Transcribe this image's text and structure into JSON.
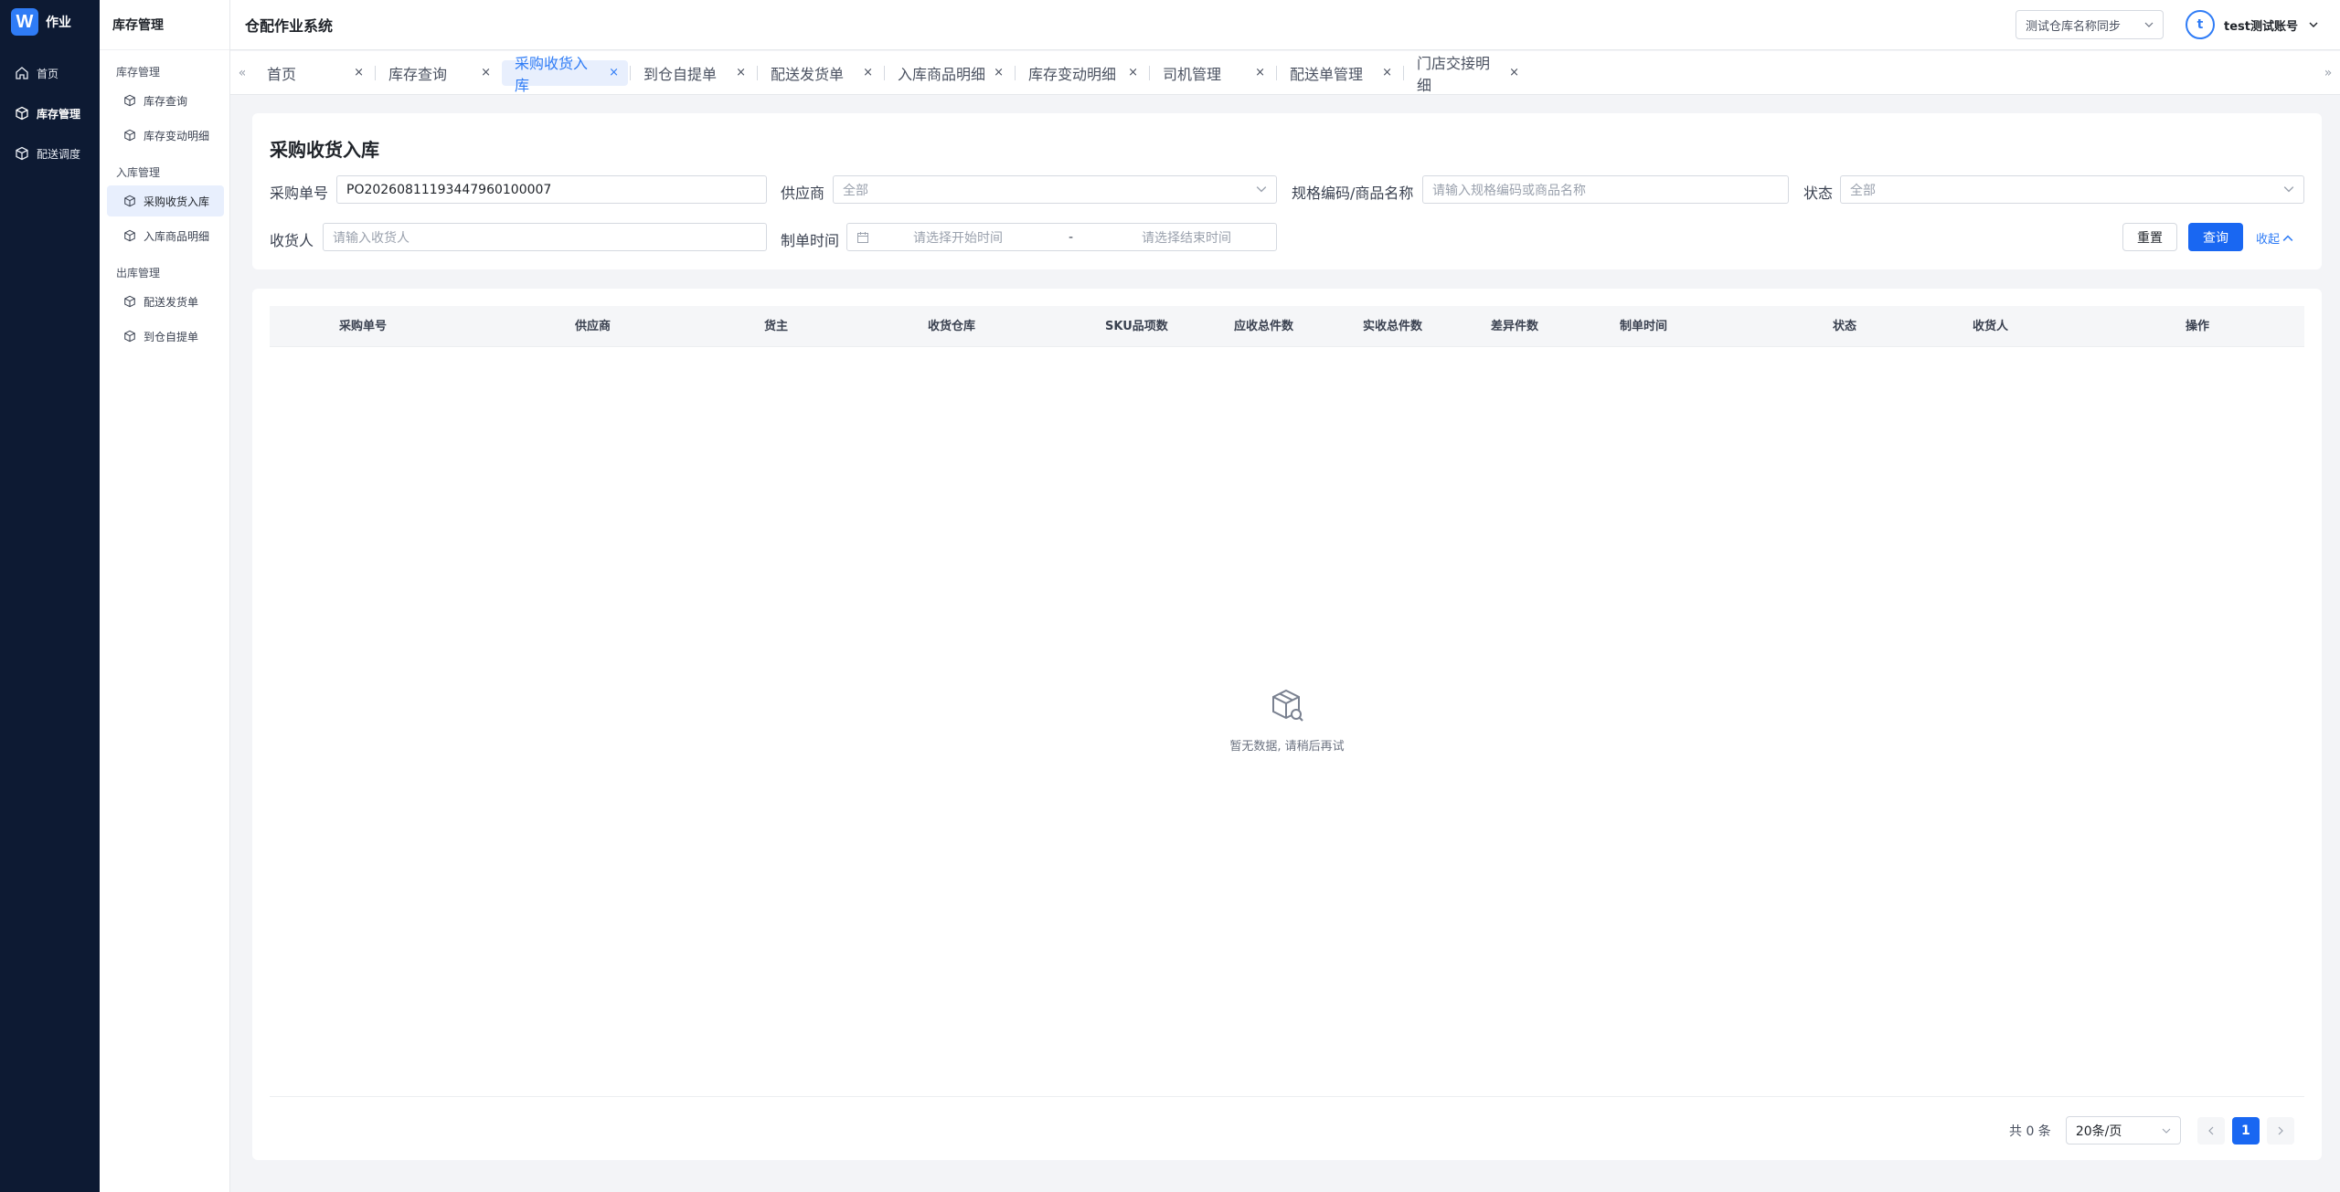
{
  "brand": {
    "logo_letter": "W",
    "name": "作业"
  },
  "rail": [
    {
      "label": "首页",
      "icon": "home-icon",
      "active": false
    },
    {
      "label": "库存管理",
      "icon": "box-icon",
      "active": true
    },
    {
      "label": "配送调度",
      "icon": "box-icon",
      "active": false
    }
  ],
  "submenu": {
    "title": "库存管理",
    "groups": [
      {
        "label": "库存管理",
        "items": [
          "库存查询",
          "库存变动明细"
        ]
      },
      {
        "label": "入库管理",
        "items": [
          "采购收货入库",
          "入库商品明细"
        ]
      },
      {
        "label": "出库管理",
        "items": [
          "配送发货单",
          "到仓自提单"
        ]
      }
    ],
    "active_item": "采购收货入库"
  },
  "header": {
    "title": "仓配作业系统",
    "warehouse_select": "测试仓库名称同步",
    "avatar_letter": "t",
    "user_name": "test测试账号"
  },
  "tabs": [
    {
      "label": "首页",
      "active": false
    },
    {
      "label": "库存查询",
      "active": false
    },
    {
      "label": "采购收货入库",
      "active": true
    },
    {
      "label": "到仓自提单",
      "active": false
    },
    {
      "label": "配送发货单",
      "active": false
    },
    {
      "label": "入库商品明细",
      "active": false
    },
    {
      "label": "库存变动明细",
      "active": false
    },
    {
      "label": "司机管理",
      "active": false
    },
    {
      "label": "配送单管理",
      "active": false
    },
    {
      "label": "门店交接明细",
      "active": false
    }
  ],
  "tab_close_glyph": "×",
  "filters": {
    "page_title": "采购收货入库",
    "po_label": "采购单号",
    "po_value": "PO20260811193447960100007",
    "supplier_label": "供应商",
    "supplier_value": "全部",
    "sku_label": "规格编码/商品名称",
    "sku_placeholder": "请输入规格编码或商品名称",
    "status_label": "状态",
    "status_value": "全部",
    "receiver_label": "收货人",
    "receiver_placeholder": "请输入收货人",
    "time_label": "制单时间",
    "time_start_placeholder": "请选择开始时间",
    "time_separator": "-",
    "time_end_placeholder": "请选择结束时间",
    "reset_label": "重置",
    "query_label": "查询",
    "collapse_label": "收起"
  },
  "table": {
    "columns": [
      "采购单号",
      "供应商",
      "货主",
      "收货仓库",
      "SKU品项数",
      "应收总件数",
      "实收总件数",
      "差异件数",
      "制单时间",
      "状态",
      "收货人",
      "操作"
    ],
    "rows": [],
    "empty_text": "暂无数据, 请稍后再试"
  },
  "pagination": {
    "total": "共 0 条",
    "page_size": "20条/页",
    "current_page": "1"
  },
  "colors": {
    "primary": "#1967f2",
    "rail_bg": "#0d1a33",
    "active_tab_bg": "#e8effd"
  }
}
